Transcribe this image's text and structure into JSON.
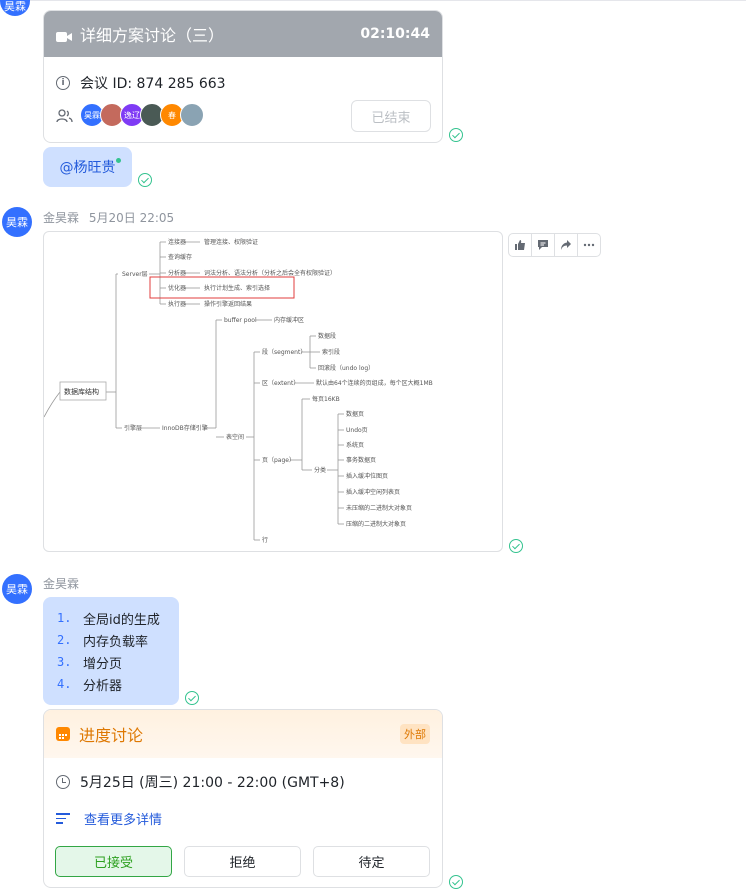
{
  "avatar_label": "昊霖",
  "meeting_card": {
    "title": "详细方案讨论（三）",
    "duration": "02:10:44",
    "meeting_id": "会议 ID: 874 285 663",
    "participants": [
      {
        "label": "昊霖",
        "color": "#3370ff"
      },
      {
        "label": "",
        "color": "#c46a5d"
      },
      {
        "label": "逸辽",
        "color": "#7f3bf5"
      },
      {
        "label": "",
        "color": "#4a5a55"
      },
      {
        "label": "春",
        "color": "#ff8800"
      },
      {
        "label": "",
        "color": "#8aa3b3"
      }
    ],
    "status_button": "已结束"
  },
  "mention_message": {
    "text": "@杨旺贵"
  },
  "image_message": {
    "sender": "金昊霖",
    "time": "5月20日 22:05",
    "toolbar": [
      "thumbs-up-icon",
      "reply-icon",
      "forward-icon",
      "more-icon"
    ],
    "mindmap": {
      "root": "数据库结构",
      "server": "Server层",
      "server_items": [
        {
          "label": "连接器",
          "note": "管理连接、权限验证"
        },
        {
          "label": "查询缓存",
          "note": ""
        },
        {
          "label": "分析器",
          "note": "词法分析、语法分析（分析之后会全有权限验证）"
        },
        {
          "label": "优化器",
          "note": "执行计划生成、索引选择"
        },
        {
          "label": "执行器",
          "note": "操作引擎返回结果"
        }
      ],
      "engine": "引擎层",
      "innodb": "InnoDB存储引擎",
      "buffer_pool": "buffer pool",
      "buffer_note": "内存缓冲区",
      "table_space": "表空间",
      "segment": "段（segment）",
      "segment_items": [
        "数据段",
        "索引段",
        "回滚段（undo log）"
      ],
      "extent": "区（extent）",
      "extent_note": "默认由64个连续的页组成，每个区大概1MB",
      "page": "页（page）",
      "page_size": "每页16KB",
      "category": "分类",
      "page_types": [
        "数据页",
        "Undo页",
        "系统页",
        "事务数据页",
        "插入缓冲位图页",
        "插入缓冲空闲列表页",
        "未压缩的二进制大对象页",
        "压缩的二进制大对象页"
      ],
      "row": "行"
    }
  },
  "list_message": {
    "sender": "金昊霖",
    "items": [
      {
        "num": "1.",
        "text": "全局id的生成"
      },
      {
        "num": "2.",
        "text": "内存负载率"
      },
      {
        "num": "3.",
        "text": "增分页"
      },
      {
        "num": "4.",
        "text": "分析器"
      }
    ]
  },
  "calendar_card": {
    "title": "进度讨论",
    "badge": "外部",
    "time": "5月25日 (周三) 21:00 - 22:00 (GMT+8)",
    "more_link": "查看更多详情",
    "buttons": {
      "accept": "已接受",
      "decline": "拒绝",
      "tentative": "待定"
    }
  },
  "colors": {
    "accent": "#3370ff",
    "bubble": "#cfe0ff",
    "read_check": "#34c38f",
    "calendar_orange": "#de7802",
    "accept_green": "#2ea121"
  }
}
